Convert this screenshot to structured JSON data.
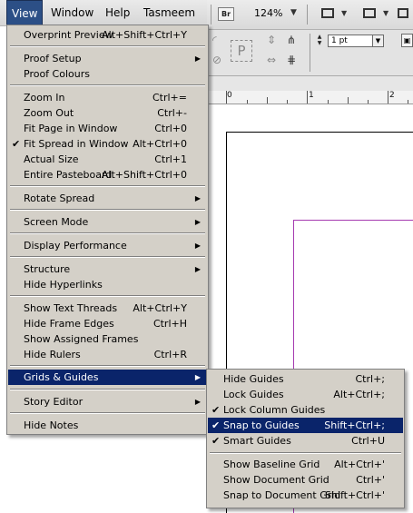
{
  "menubar": {
    "items": [
      "View",
      "Window",
      "Help",
      "Tasmeem"
    ]
  },
  "toolbar": {
    "bridge_label": "Br",
    "zoom": "124%"
  },
  "control_panel": {
    "stroke_weight": "1 pt",
    "p_label": "P"
  },
  "ruler": {
    "labels": [
      "0",
      "1",
      "2"
    ]
  },
  "view_menu": {
    "items": [
      {
        "label": "Overprint Preview",
        "shortcut": "Alt+Shift+Ctrl+Y"
      },
      {
        "label": "Proof Setup",
        "submenu": true
      },
      {
        "label": "Proof Colours"
      },
      {
        "label": "Zoom In",
        "shortcut": "Ctrl+="
      },
      {
        "label": "Zoom Out",
        "shortcut": "Ctrl+-"
      },
      {
        "label": "Fit Page in Window",
        "shortcut": "Ctrl+0"
      },
      {
        "label": "Fit Spread in Window",
        "shortcut": "Alt+Ctrl+0",
        "checked": true
      },
      {
        "label": "Actual Size",
        "shortcut": "Ctrl+1"
      },
      {
        "label": "Entire Pasteboard",
        "shortcut": "Alt+Shift+Ctrl+0"
      },
      {
        "label": "Rotate Spread",
        "submenu": true
      },
      {
        "label": "Screen Mode",
        "submenu": true
      },
      {
        "label": "Display Performance",
        "submenu": true
      },
      {
        "label": "Structure",
        "submenu": true
      },
      {
        "label": "Hide Hyperlinks"
      },
      {
        "label": "Show Text Threads",
        "shortcut": "Alt+Ctrl+Y"
      },
      {
        "label": "Hide Frame Edges",
        "shortcut": "Ctrl+H"
      },
      {
        "label": "Show Assigned Frames"
      },
      {
        "label": "Hide Rulers",
        "shortcut": "Ctrl+R"
      },
      {
        "label": "Grids & Guides",
        "submenu": true,
        "highlighted": true
      },
      {
        "label": "Story Editor",
        "submenu": true
      },
      {
        "label": "Hide Notes"
      }
    ]
  },
  "grids_guides_submenu": {
    "items": [
      {
        "label": "Hide Guides",
        "shortcut": "Ctrl+;"
      },
      {
        "label": "Lock Guides",
        "shortcut": "Alt+Ctrl+;"
      },
      {
        "label": "Lock Column Guides",
        "checked": true
      },
      {
        "label": "Snap to Guides",
        "shortcut": "Shift+Ctrl+;",
        "checked": true,
        "highlighted": true
      },
      {
        "label": "Smart Guides",
        "shortcut": "Ctrl+U",
        "checked": true
      },
      {
        "label": "Show Baseline Grid",
        "shortcut": "Alt+Ctrl+'"
      },
      {
        "label": "Show Document Grid",
        "shortcut": "Ctrl+'"
      },
      {
        "label": "Snap to Document Grid",
        "shortcut": "Shift+Ctrl+'"
      }
    ]
  },
  "glyphs": {
    "checkmark": "✔",
    "submenu_arrow": "▶",
    "dropdown_arrow": "▼"
  },
  "colors": {
    "menu_bg": "#d4d0c8",
    "highlight": "#0a246a",
    "margin_guide": "#a53ab0"
  }
}
